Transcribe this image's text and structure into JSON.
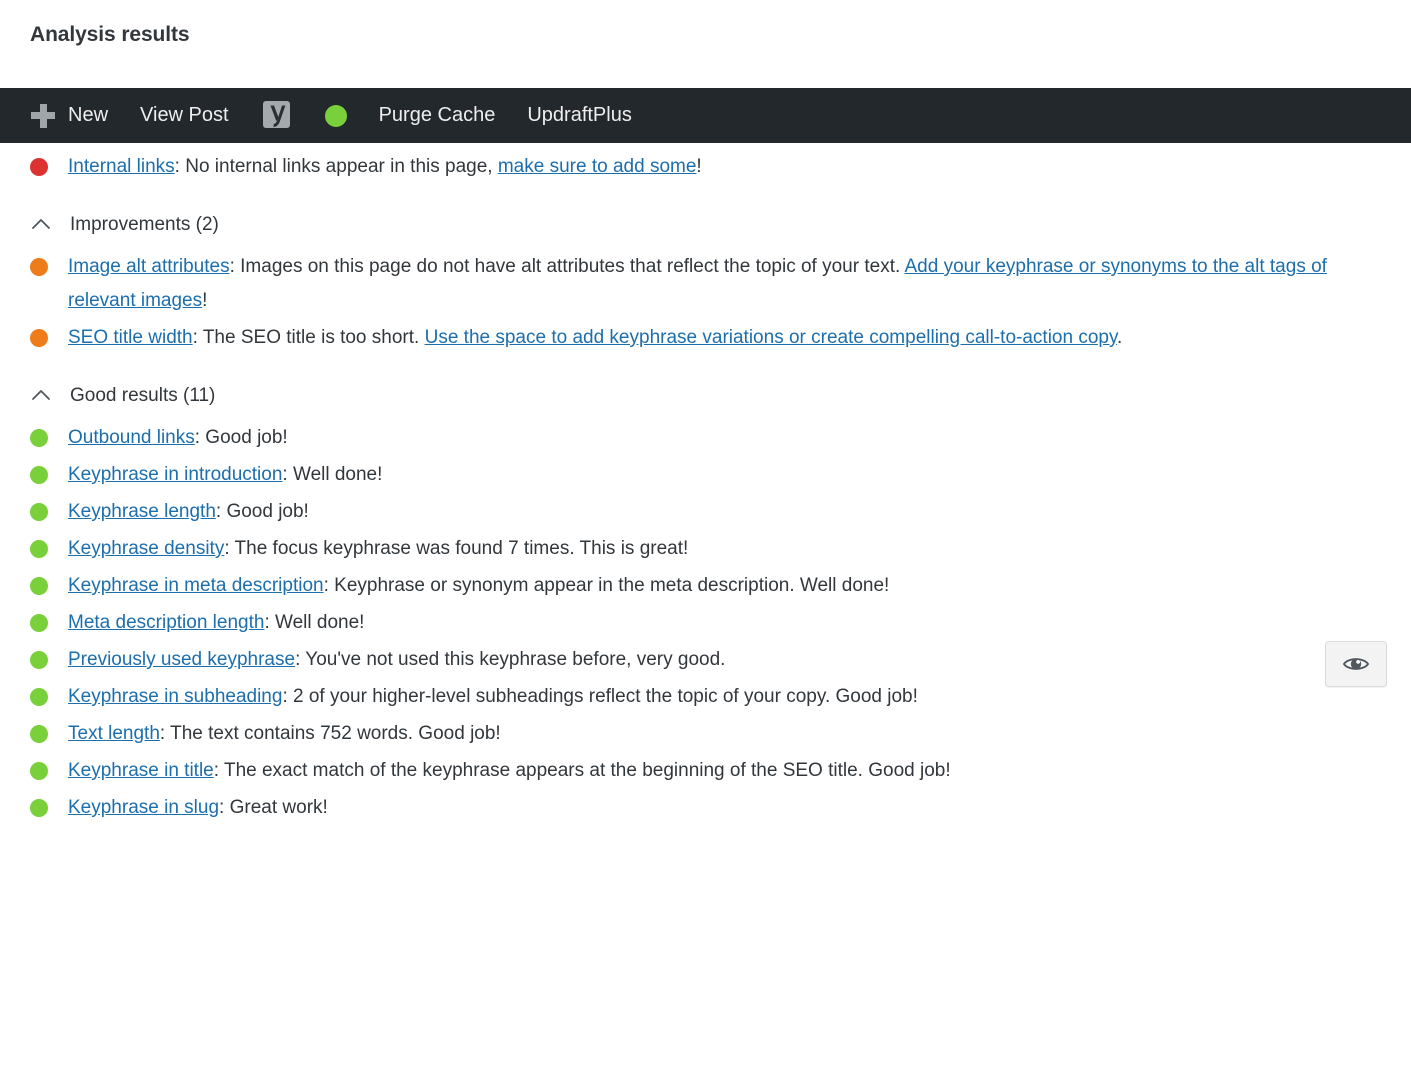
{
  "page": {
    "title": "Analysis results"
  },
  "admin_bar": {
    "items": [
      {
        "id": "new",
        "label": "New",
        "icon": "plus-icon"
      },
      {
        "id": "view-post",
        "label": "View Post",
        "icon": null
      },
      {
        "id": "yoast-seo",
        "label": "",
        "icon": "yoast-logo-icon"
      },
      {
        "id": "seo-score",
        "label": "",
        "icon": "green-dot-icon"
      },
      {
        "id": "purge-cache",
        "label": "Purge Cache",
        "icon": null
      },
      {
        "id": "updraftplus",
        "label": "UpdraftPlus",
        "icon": null
      }
    ]
  },
  "problems": {
    "items": [
      {
        "bullet": "bad",
        "link_text": "Internal links",
        "text_a": ": No internal links appear in this page, ",
        "link2_text": "make sure to add some",
        "text_b": "!"
      }
    ]
  },
  "improvements": {
    "header": "Improvements (2)",
    "collapse_icon": "chevron-up-icon",
    "items": [
      {
        "bullet": "ok",
        "link_text": "Image alt attributes",
        "text_a": ": Images on this page do not have alt attributes that reflect the topic of your text. ",
        "link2_text": "Add your keyphrase or synonyms to the alt tags of relevant images",
        "text_b": "!"
      },
      {
        "bullet": "ok",
        "link_text": "SEO title width",
        "text_a": ": The SEO title is too short. ",
        "link2_text": "Use the space to add keyphrase variations or create compelling call-to-action copy",
        "text_b": "."
      }
    ]
  },
  "good_results": {
    "header": "Good results (11)",
    "collapse_icon": "chevron-up-icon",
    "items": [
      {
        "bullet": "good",
        "link_text": "Outbound links",
        "text_a": ": Good job!",
        "link2_text": "",
        "text_b": ""
      },
      {
        "bullet": "good",
        "link_text": "Keyphrase in introduction",
        "text_a": ": Well done!",
        "link2_text": "",
        "text_b": ""
      },
      {
        "bullet": "good",
        "link_text": "Keyphrase length",
        "text_a": ": Good job!",
        "link2_text": "",
        "text_b": ""
      },
      {
        "bullet": "good",
        "link_text": "Keyphrase density",
        "text_a": ": The focus keyphrase was found 7 times. This is great!",
        "link2_text": "",
        "text_b": ""
      },
      {
        "bullet": "good",
        "link_text": "Keyphrase in meta description",
        "text_a": ": Keyphrase or synonym appear in the meta description. Well done!",
        "link2_text": "",
        "text_b": ""
      },
      {
        "bullet": "good",
        "link_text": "Meta description length",
        "text_a": ": Well done!",
        "link2_text": "",
        "text_b": ""
      },
      {
        "bullet": "good",
        "link_text": "Previously used keyphrase",
        "text_a": ": You've not used this keyphrase before, very good.",
        "link2_text": "",
        "text_b": ""
      },
      {
        "bullet": "good",
        "link_text": "Keyphrase in subheading",
        "text_a": ": 2 of your higher-level subheadings reflect the topic of your copy. Good job!",
        "link2_text": "",
        "text_b": ""
      },
      {
        "bullet": "good",
        "link_text": "Text length",
        "text_a": ": The text contains 752 words. Good job!",
        "link2_text": "",
        "text_b": ""
      },
      {
        "bullet": "good",
        "link_text": "Keyphrase in title",
        "text_a": ": The exact match of the keyphrase appears at the beginning of the SEO title. Good job!",
        "link2_text": "",
        "text_b": ""
      },
      {
        "bullet": "good",
        "link_text": "Keyphrase in slug",
        "text_a": ": Great work!",
        "link2_text": "",
        "text_b": ""
      }
    ]
  },
  "floating_button": {
    "icon": "eye-icon",
    "label": ""
  },
  "colors": {
    "admin_bar_bg": "#23282d",
    "bad": "#dc3232",
    "ok": "#ee7c1b",
    "good": "#7ad03a",
    "link": "#1c6ead",
    "text": "#32373c"
  }
}
